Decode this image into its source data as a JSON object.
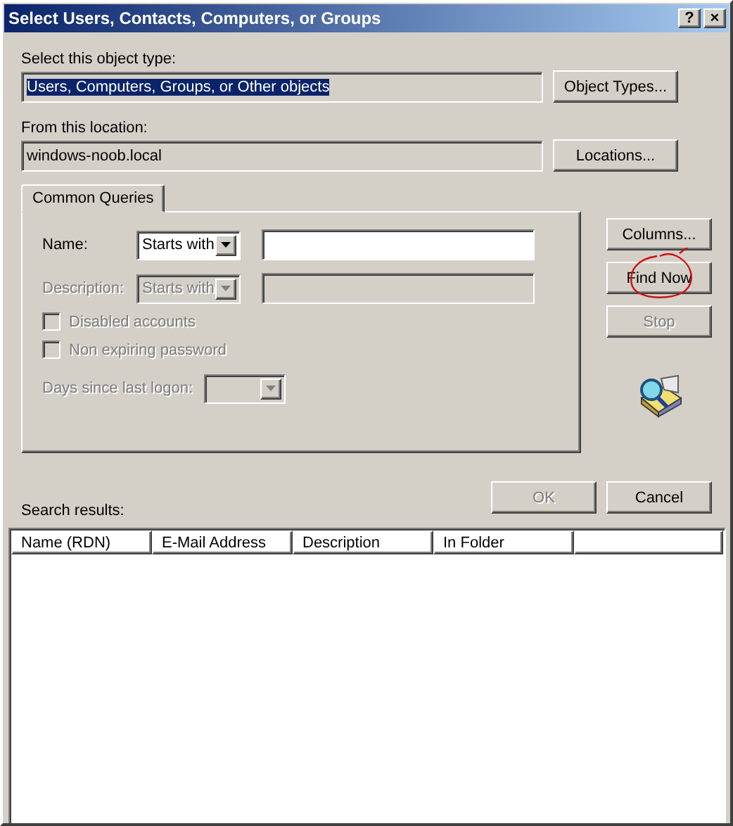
{
  "window": {
    "title": "Select Users, Contacts, Computers, or Groups",
    "title_buttons": [
      "?",
      "×"
    ]
  },
  "object_type": {
    "label": "Select this object type:",
    "value": "Users, Computers, Groups, or Other objects",
    "value_selected": true,
    "button": "Object Types..."
  },
  "location": {
    "label": "From this location:",
    "value": "windows-noob.local",
    "value_selected": false,
    "button": "Locations..."
  },
  "tabs": [
    {
      "label": "Common Queries",
      "selected": true
    }
  ],
  "queries": [
    {
      "label": "Name:",
      "operator": "Starts with",
      "disabled": false
    },
    {
      "label": "Description:",
      "operator": "Starts with",
      "disabled": true
    }
  ],
  "checkboxes": [
    {
      "label": "Disabled accounts",
      "checked": false,
      "disabled": true
    },
    {
      "label": "Non expiring password",
      "checked": false,
      "disabled": true
    }
  ],
  "days": {
    "label": "Days since last logon:",
    "disabled": true
  },
  "side_buttons": [
    {
      "label": "Columns...",
      "disabled": false,
      "annotated": false
    },
    {
      "label": "Find Now",
      "disabled": false,
      "annotated": true
    },
    {
      "label": "Stop",
      "disabled": true,
      "annotated": false
    }
  ],
  "results_label": "Search results:",
  "dialog_buttons": [
    {
      "label": "OK",
      "disabled": true
    },
    {
      "label": "Cancel",
      "disabled": false
    }
  ],
  "results_columns": [
    "Name (RDN)",
    "E-Mail Address",
    "Description",
    "In Folder"
  ]
}
